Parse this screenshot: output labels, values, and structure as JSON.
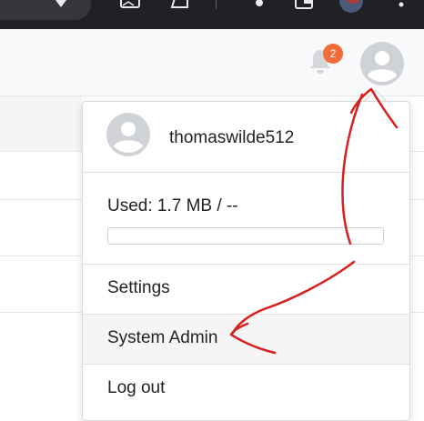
{
  "header": {
    "notification_count": "2"
  },
  "user_menu": {
    "username": "thomaswilde512",
    "usage_label": "Used: 1.7 MB / --",
    "usage_fraction": 0,
    "items": [
      {
        "label": "Settings"
      },
      {
        "label": "System Admin"
      },
      {
        "label": "Log out"
      }
    ]
  },
  "colors": {
    "badge": "#f26b3a",
    "annotation": "#d81e1e",
    "header_bg": "#f8f9fa",
    "hover_row": "#f5f5f5"
  },
  "icons": [
    "bell-icon",
    "avatar-icon",
    "star-icon",
    "more-vert-icon"
  ]
}
